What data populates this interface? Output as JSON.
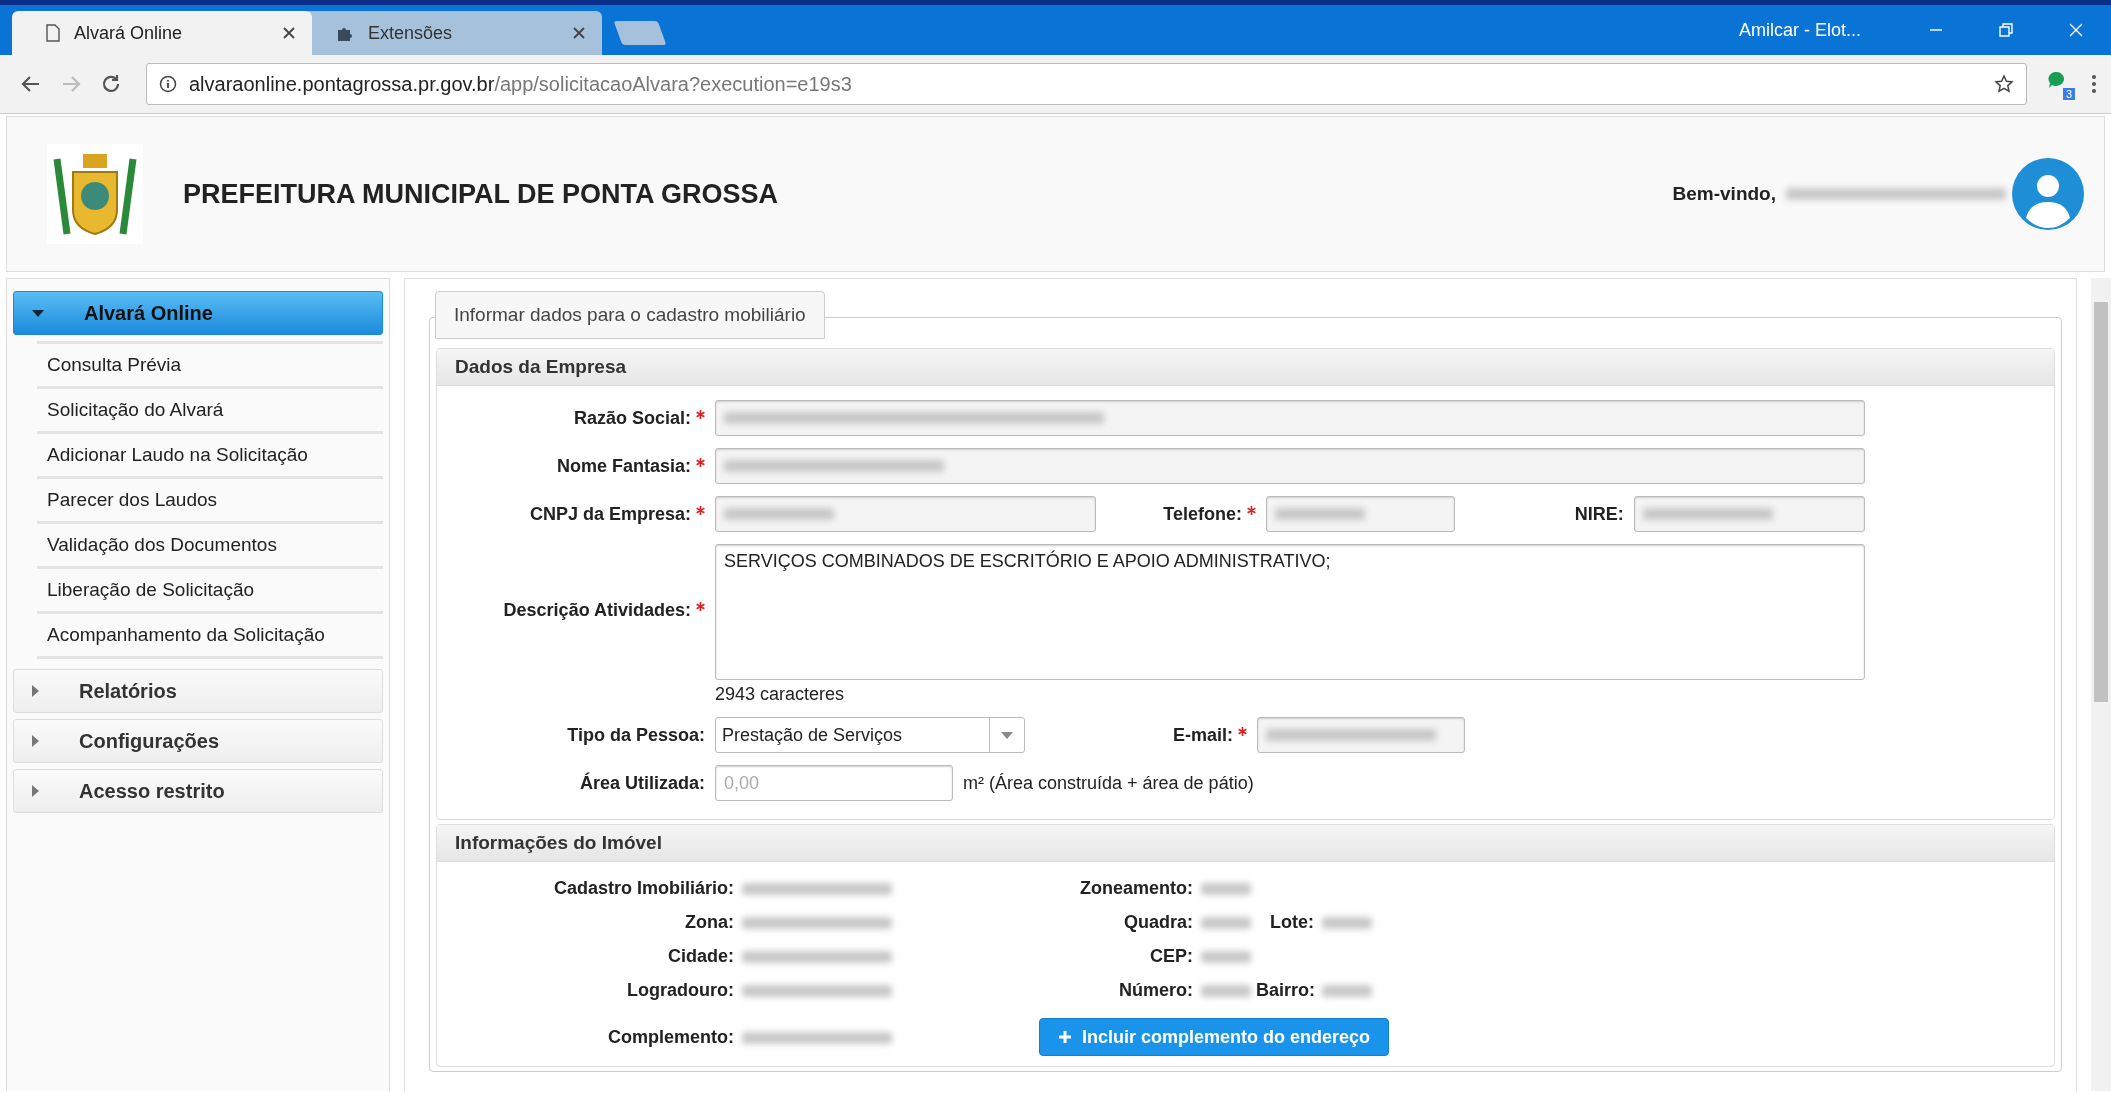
{
  "browser": {
    "tabs": [
      {
        "title": "Alvará Online",
        "kind": "page",
        "selected": true
      },
      {
        "title": "Extensões",
        "kind": "extension",
        "selected": false
      }
    ],
    "profile": "Amilcar - Elot...",
    "url_host": "alvaraonline.pontagrossa.pr.gov.br",
    "url_path": "/app/solicitacaoAlvara?execution=e19s3",
    "extension_badge": "3"
  },
  "header": {
    "title": "PREFEITURA MUNICIPAL DE PONTA GROSSA",
    "welcome": "Bem-vindo,"
  },
  "sidebar": [
    {
      "label": "Alvará Online",
      "expanded": true,
      "items": [
        "Consulta Prévia",
        "Solicitação do Alvará",
        "Adicionar Laudo na Solicitação",
        "Parecer dos Laudos",
        "Validação dos Documentos",
        "Liberação de Solicitação",
        "Acompanhamento da Solicitação"
      ]
    },
    {
      "label": "Relatórios",
      "expanded": false
    },
    {
      "label": "Configurações",
      "expanded": false
    },
    {
      "label": "Acesso restrito",
      "expanded": false
    }
  ],
  "form_tab": "Informar dados para o cadastro mobiliário",
  "company": {
    "title": "Dados da Empresa",
    "razao": {
      "label": "Razão Social:",
      "required": true
    },
    "fantasia": {
      "label": "Nome Fantasia:",
      "required": true
    },
    "cnpj": {
      "label": "CNPJ da Empresa:",
      "required": true
    },
    "telefone": {
      "label": "Telefone:",
      "required": true
    },
    "nire": {
      "label": "NIRE:",
      "required": false
    },
    "descricao": {
      "label": "Descrição Atividades:",
      "required": true,
      "value": "SERVIÇOS COMBINADOS DE ESCRITÓRIO E APOIO ADMINISTRATIVO;",
      "counter": "2943 caracteres"
    },
    "tipo": {
      "label": "Tipo da Pessoa:",
      "value": "Prestação de Serviços"
    },
    "email": {
      "label": "E-mail:",
      "required": true
    },
    "area": {
      "label": "Área Utilizada:",
      "placeholder": "0,00",
      "unit": "m² (Área construída + área de pátio)"
    }
  },
  "property": {
    "title": "Informações do Imóvel",
    "rows": [
      [
        {
          "label": "Cadastro Imobiliário:"
        },
        {
          "label": "Zoneamento:"
        }
      ],
      [
        {
          "label": "Zona:"
        },
        {
          "label": "Quadra:"
        },
        {
          "label": "Lote:"
        }
      ],
      [
        {
          "label": "Cidade:"
        },
        {
          "label": "CEP:"
        }
      ],
      [
        {
          "label": "Logradouro:"
        },
        {
          "label": "Número:"
        },
        {
          "label": "Bairro:"
        }
      ],
      [
        {
          "label": "Complemento:"
        }
      ]
    ],
    "button": "Incluir complemento do endereço"
  }
}
